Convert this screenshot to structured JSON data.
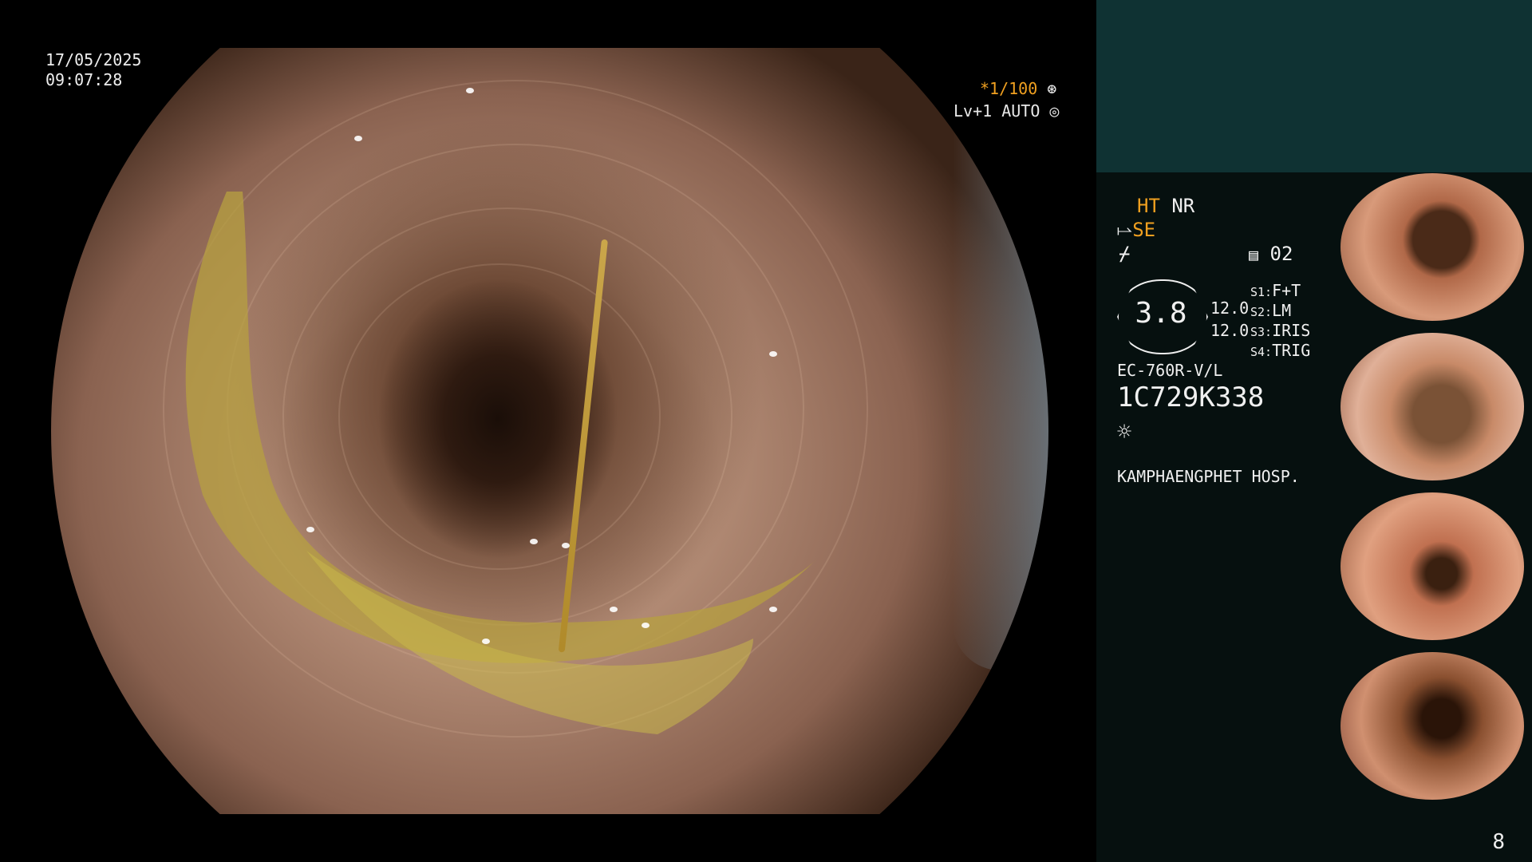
{
  "overlay": {
    "date": "17/05/2025",
    "time": "09:07:28",
    "shutter": "*1/100",
    "shutter_icon": "aperture-icon",
    "level": "Lv+1 AUTO",
    "level_icon": "iris-icon"
  },
  "panel": {
    "ht": "HT",
    "nr": "NR",
    "se": "SE",
    "counter": "02",
    "badge_value": "3.8",
    "val1": "12.0",
    "val2": "12.0",
    "s1_key": "S1:",
    "s1_val": "F+T",
    "s2_key": "S2:",
    "s2_val": "LM",
    "s3_key": "S3:",
    "s3_val": "IRIS",
    "s4_key": "S4:",
    "s4_val": "TRIG",
    "scope_model": "EC-760R-V/L",
    "serial": "1C729K338",
    "hospital": "KAMPHAENGPHET HOSP.",
    "page_number": "8"
  },
  "colors": {
    "panel_top": "#0f3233",
    "panel_bg": "#06100f",
    "accent_orange": "#f0a020"
  }
}
